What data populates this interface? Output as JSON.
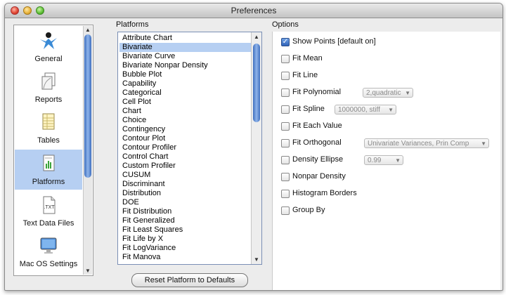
{
  "window": {
    "title": "Preferences"
  },
  "sidebar": {
    "items": [
      {
        "label": "General",
        "icon": "general-icon"
      },
      {
        "label": "Reports",
        "icon": "reports-icon"
      },
      {
        "label": "Tables",
        "icon": "tables-icon"
      },
      {
        "label": "Platforms",
        "icon": "platforms-icon",
        "selected": true
      },
      {
        "label": "Text Data Files",
        "icon": "text-data-files-icon"
      },
      {
        "label": "Mac OS Settings",
        "icon": "mac-os-settings-icon"
      }
    ]
  },
  "platforms": {
    "label": "Platforms",
    "items": [
      "Attribute Chart",
      "Bivariate",
      "Bivariate Curve",
      "Bivariate Nonpar Density",
      "Bubble Plot",
      "Capability",
      "Categorical",
      "Cell Plot",
      "Chart",
      "Choice",
      "Contingency",
      "Contour Plot",
      "Contour Profiler",
      "Control Chart",
      "Custom Profiler",
      "CUSUM",
      "Discriminant",
      "Distribution",
      "DOE",
      "Fit Distribution",
      "Fit Generalized",
      "Fit Least Squares",
      "Fit Life by X",
      "Fit LogVariance",
      "Fit Manova"
    ],
    "selected_index": 1,
    "reset_button": "Reset Platform to Defaults"
  },
  "options": {
    "label": "Options",
    "items": [
      {
        "label": "Show Points [default on]",
        "checked": true
      },
      {
        "label": "Fit Mean",
        "checked": false
      },
      {
        "label": "Fit Line",
        "checked": false
      },
      {
        "label": "Fit Polynomial",
        "checked": false,
        "dropdown": "2,quadratic"
      },
      {
        "label": "Fit Spline",
        "checked": false,
        "dropdown": "1000000, stiff"
      },
      {
        "label": "Fit Each Value",
        "checked": false
      },
      {
        "label": "Fit Orthogonal",
        "checked": false,
        "dropdown": "Univariate Variances, Prin Comp"
      },
      {
        "label": "Density Ellipse",
        "checked": false,
        "dropdown": "0.99"
      },
      {
        "label": "Nonpar Density",
        "checked": false
      },
      {
        "label": "Histogram Borders",
        "checked": false
      },
      {
        "label": "Group By",
        "checked": false
      }
    ]
  },
  "colors": {
    "selection": "#b6cff2",
    "accent": "#2f62b8"
  }
}
